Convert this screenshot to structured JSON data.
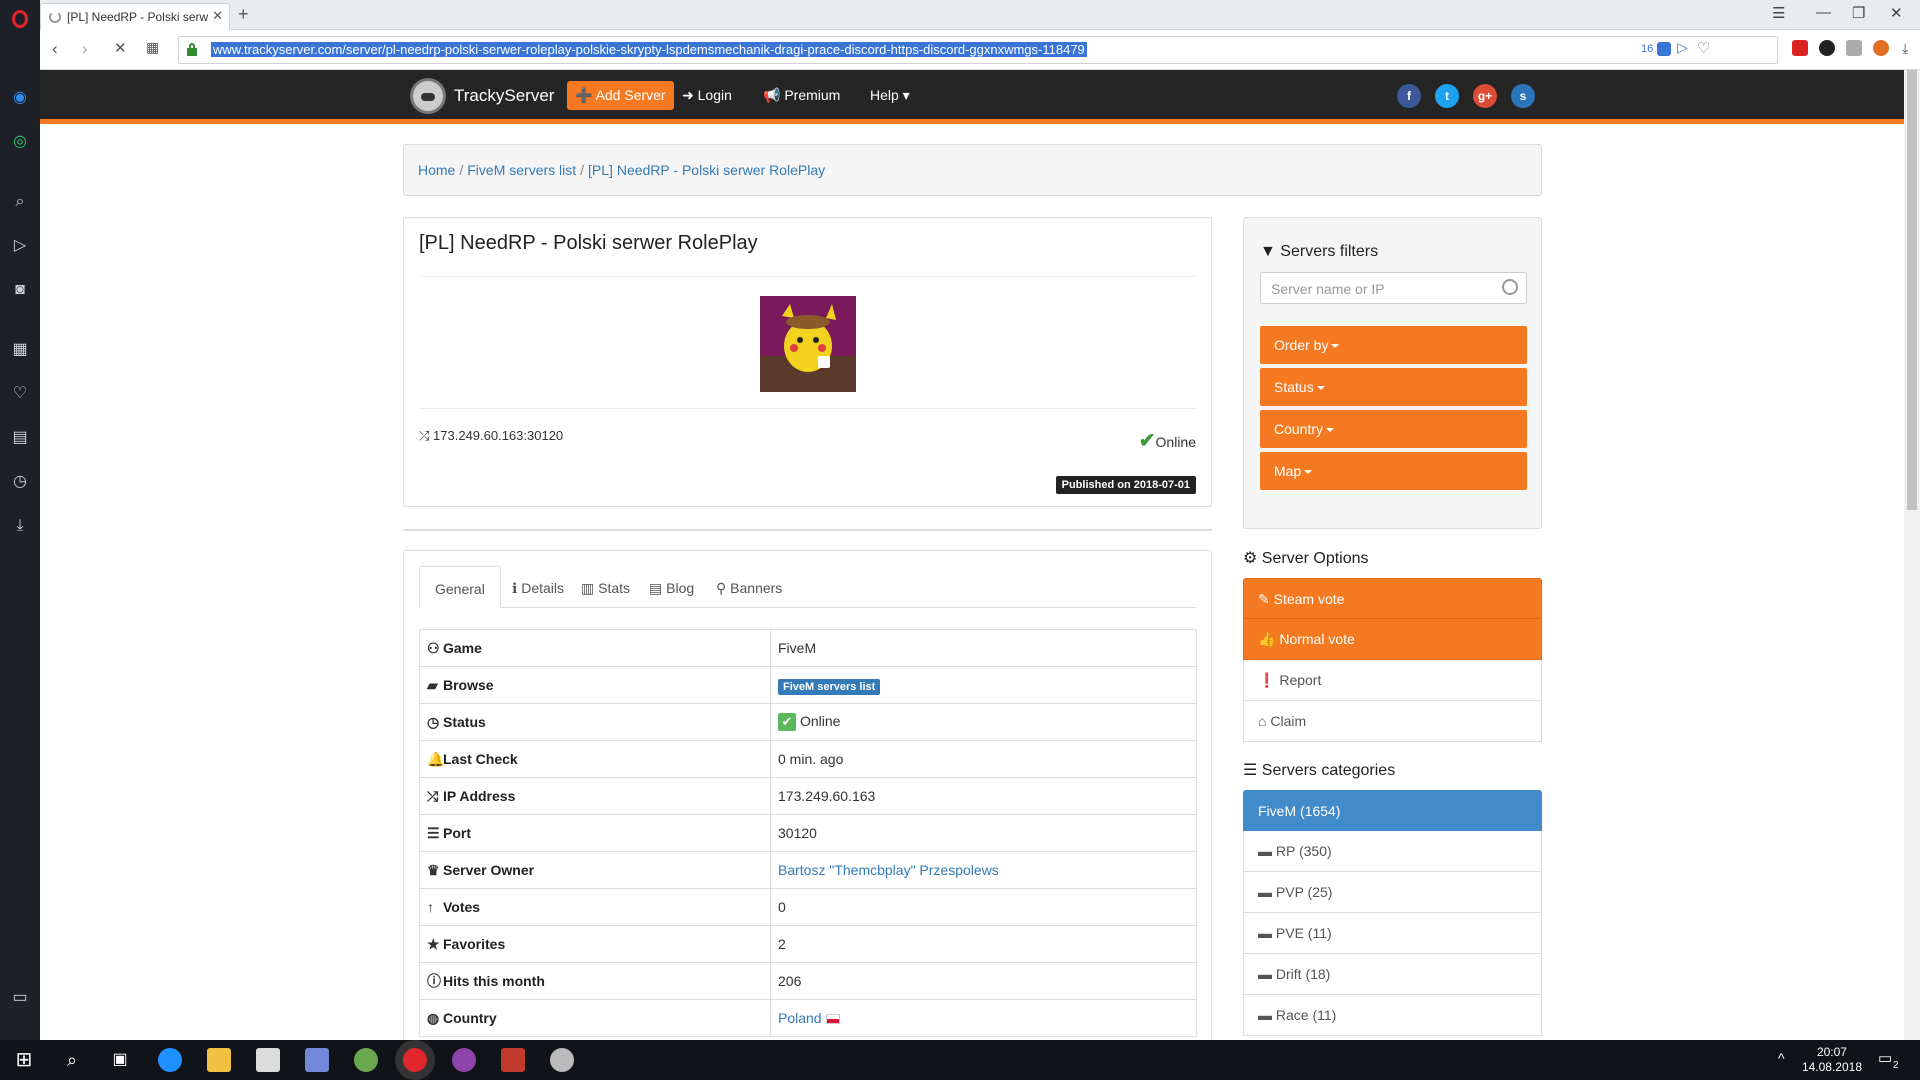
{
  "browser": {
    "tab_title": "[PL] NeedRP - Polski serw",
    "url": "www.trackyserver.com/server/pl-needrp-polski-serwer-roleplay-polskie-skrypty-lspdemsmechanik-dragi-prace-discord-https-discord-ggxnxwmgs-118479",
    "ext_count": "16"
  },
  "site": {
    "brand": "TrackyServer",
    "add_server": "Add Server",
    "login": "Login",
    "premium": "Premium",
    "help": "Help",
    "social": [
      "f",
      "t",
      "g+",
      "s"
    ]
  },
  "breadcrumb": [
    "Home",
    "FiveM servers list",
    "[PL] NeedRP - Polski serwer RolePlay"
  ],
  "server": {
    "title": "[PL] NeedRP - Polski serwer RolePlay",
    "ip_port": "173.249.60.163:30120",
    "status": "Online",
    "published": "Published on 2018-07-01"
  },
  "tabs": [
    "General",
    "Details",
    "Stats",
    "Blog",
    "Banners"
  ],
  "info": [
    {
      "key": "Game",
      "value": "FiveM"
    },
    {
      "key": "Browse",
      "value": "FiveM servers list"
    },
    {
      "key": "Status",
      "value": "Online"
    },
    {
      "key": "Last Check",
      "value": "0 min. ago"
    },
    {
      "key": "IP Address",
      "value": "173.249.60.163"
    },
    {
      "key": "Port",
      "value": "30120"
    },
    {
      "key": "Server Owner",
      "value": "Bartosz \"Themcbplay\" Przespolews"
    },
    {
      "key": "Votes",
      "value": "0"
    },
    {
      "key": "Favorites",
      "value": "2"
    },
    {
      "key": "Hits this month",
      "value": "206"
    },
    {
      "key": "Country",
      "value": "Poland"
    }
  ],
  "filters": {
    "title": "Servers filters",
    "placeholder": "Server name or IP",
    "order_by": "Order by",
    "status": "Status",
    "country": "Country",
    "map": "Map"
  },
  "options": {
    "title": "Server Options",
    "steam_vote": "Steam vote",
    "normal_vote": "Normal vote",
    "report": "Report",
    "claim": "Claim"
  },
  "categories": {
    "title": "Servers categories",
    "items": [
      "FiveM (1654)",
      "RP (350)",
      "PVP (25)",
      "PVE (11)",
      "Drift (18)",
      "Race (11)"
    ]
  },
  "clock": {
    "time": "20:07",
    "date": "14.08.2018"
  },
  "notif_count": "2",
  "colors": {
    "accent": "#f47920",
    "link": "#337ab7",
    "header": "#252525"
  }
}
